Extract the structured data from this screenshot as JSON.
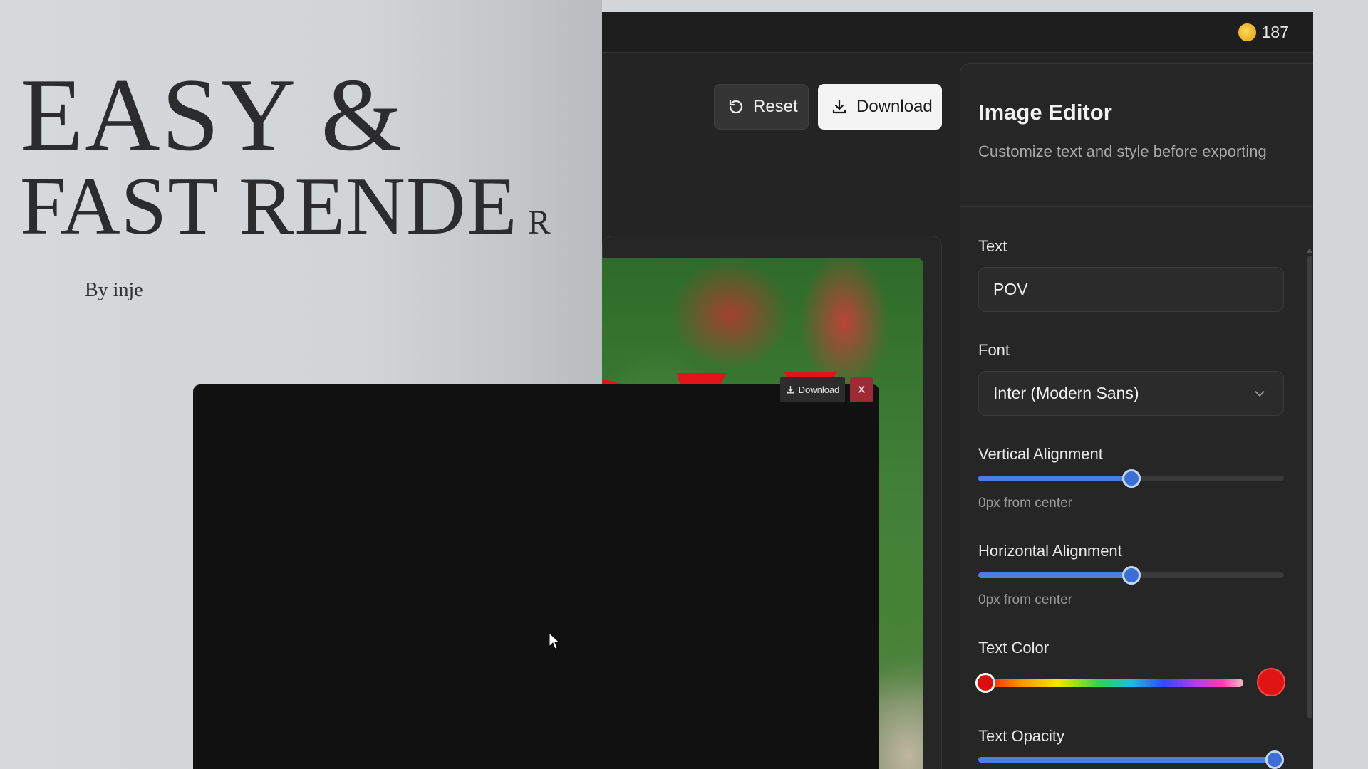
{
  "hero": {
    "line1": "EASY &",
    "line2": "FAST RENDE",
    "line2_tail": "R",
    "byline": "By inje"
  },
  "app": {
    "credits": "187",
    "reset_label": "Reset",
    "download_label": "Download"
  },
  "editor": {
    "title": "Image Editor",
    "subtitle": "Customize text and style before exporting",
    "text_label": "Text",
    "text_value": "POV",
    "font_label": "Font",
    "font_value": "Inter (Modern Sans)",
    "vertical_label": "Vertical Alignment",
    "vertical_hint": "0px from center",
    "vertical_level": 0.5,
    "horizontal_label": "Horizontal Alignment",
    "horizontal_hint": "0px from center",
    "horizontal_level": 0.5,
    "color_label": "Text Color",
    "color_value": "#e01414",
    "opacity_label": "Text Opacity",
    "opacity_level": 1.0
  },
  "modal": {
    "download_label": "Download",
    "close_label": "X"
  },
  "colors": {
    "accent": "#4a7fe0",
    "text_color": "#e01414",
    "close_button": "#9c2b35"
  },
  "icons": [
    "coin-icon",
    "reset-icon",
    "download-icon",
    "chevron-down-icon",
    "cursor-icon"
  ]
}
